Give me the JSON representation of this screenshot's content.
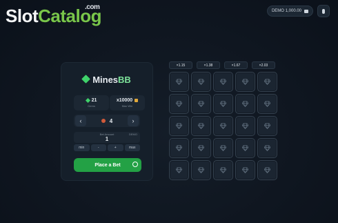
{
  "watermark": {
    "slot": "Slot",
    "catalog": "Catalog",
    "com": ".com"
  },
  "topbar": {
    "balance": "DEMO 1,000.00",
    "balance_icon": "wallet-icon",
    "sound_icon": "microphone-icon"
  },
  "game": {
    "title_main": "Mines",
    "title_accent": "BB",
    "stats": [
      {
        "value": "21",
        "label": "Gems",
        "icon": "gem-icon"
      },
      {
        "value": "x10000",
        "label": "Max Win",
        "icon": "bag-icon"
      }
    ],
    "mines_count": "4",
    "bet_label": "Bet Amount",
    "bet_currency": "DEMO",
    "bet_amount": "1",
    "bet_buttons": [
      "min",
      "-",
      "+",
      "max"
    ],
    "place_bet": "Place a Bet",
    "prev": "‹",
    "next": "›"
  },
  "multipliers": [
    "×1.15",
    "×1.38",
    "×1.67",
    "×2.03"
  ],
  "grid": {
    "rows": 5,
    "cols": 5,
    "cell_icon": "diamond-icon"
  },
  "colors": {
    "accent_green": "#23a145",
    "gem_green": "#3fd26a",
    "background": "#0f1620"
  }
}
